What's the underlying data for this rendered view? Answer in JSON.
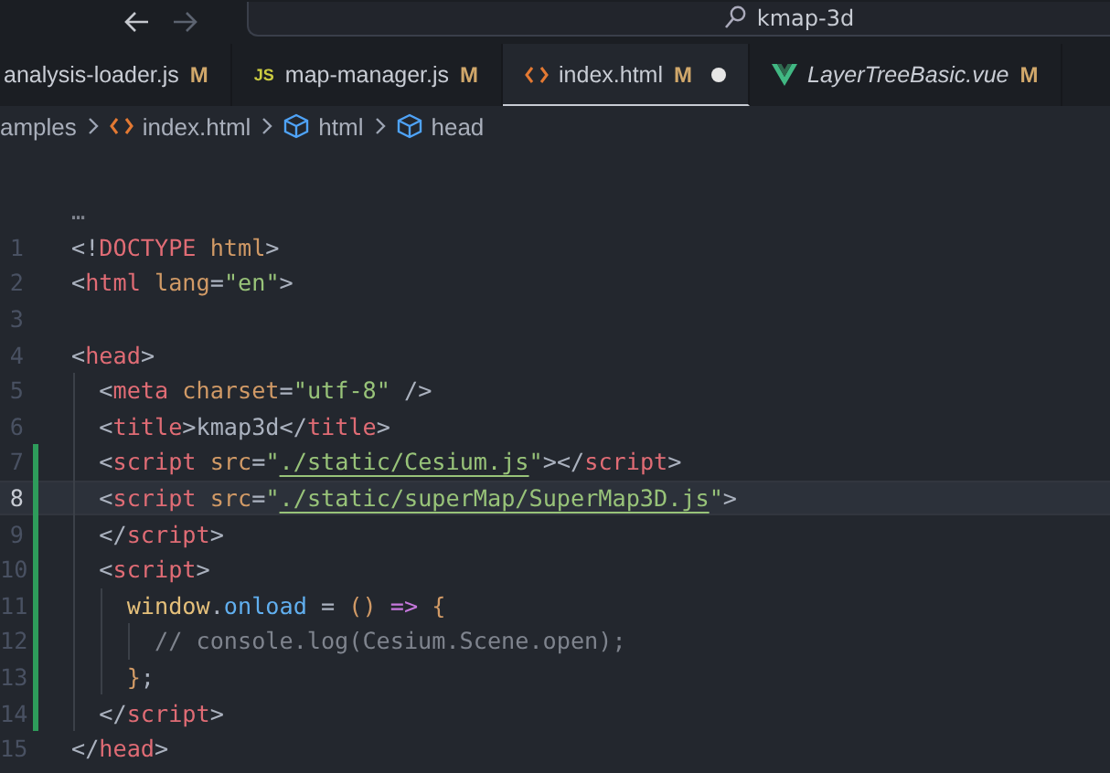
{
  "title_bar": {
    "search": {
      "value": "kmap-3d"
    }
  },
  "tabs": [
    {
      "label": "analysis-loader.js",
      "badge": "M",
      "selected": false,
      "dirty": false,
      "italic": false
    },
    {
      "label": "map-manager.js",
      "kind": "js",
      "icon_text": "JS",
      "badge": "M",
      "selected": false,
      "dirty": false,
      "italic": false
    },
    {
      "label": "index.html",
      "kind": "html",
      "badge": "M",
      "selected": true,
      "dirty": true,
      "italic": false
    },
    {
      "label": "LayerTreeBasic.vue",
      "kind": "vue",
      "badge": "M",
      "selected": false,
      "dirty": false,
      "italic": true
    }
  ],
  "breadcrumb": [
    {
      "label": "amples",
      "kind": "folder"
    },
    {
      "label": "index.html",
      "kind": "html"
    },
    {
      "label": "html",
      "kind": "element"
    },
    {
      "label": "head",
      "kind": "element"
    }
  ],
  "editor": {
    "fold_marker": "…",
    "lines": [
      {
        "number": "1",
        "modified": false,
        "current": false,
        "tokens": [
          {
            "kind": "punct",
            "text": "<!"
          },
          {
            "kind": "tag",
            "text": "DOCTYPE"
          },
          {
            "kind": "attr",
            "text": " html"
          },
          {
            "kind": "punct",
            "text": ">"
          }
        ]
      },
      {
        "number": "2",
        "modified": false,
        "current": false,
        "tokens": [
          {
            "kind": "punct",
            "text": "<"
          },
          {
            "kind": "tag",
            "text": "html"
          },
          {
            "kind": "attr",
            "text": " lang"
          },
          {
            "kind": "punct",
            "text": "="
          },
          {
            "kind": "string",
            "text": "\"en\""
          },
          {
            "kind": "punct",
            "text": ">"
          }
        ]
      },
      {
        "number": "3",
        "modified": false,
        "current": false
      },
      {
        "number": "4",
        "modified": false,
        "current": false,
        "tokens": [
          {
            "kind": "punct",
            "text": "<"
          },
          {
            "kind": "tag",
            "text": "head"
          },
          {
            "kind": "punct",
            "text": ">"
          }
        ]
      },
      {
        "number": "5",
        "modified": false,
        "current": false,
        "tokens": [
          {
            "kind": "punct",
            "text": "  <"
          },
          {
            "kind": "tag",
            "text": "meta"
          },
          {
            "kind": "attr",
            "text": " charset"
          },
          {
            "kind": "punct",
            "text": "="
          },
          {
            "kind": "string",
            "text": "\"utf-8\""
          },
          {
            "kind": "punct",
            "text": " />"
          }
        ]
      },
      {
        "number": "6",
        "modified": false,
        "current": false,
        "tokens": [
          {
            "kind": "punct",
            "text": "  <"
          },
          {
            "kind": "tag",
            "text": "title"
          },
          {
            "kind": "punct",
            "text": ">"
          },
          {
            "kind": "text",
            "text": "kmap3d"
          },
          {
            "kind": "punct",
            "text": "</"
          },
          {
            "kind": "tag",
            "text": "title"
          },
          {
            "kind": "punct",
            "text": ">"
          }
        ]
      },
      {
        "number": "7",
        "modified": true,
        "current": false,
        "tokens": [
          {
            "kind": "punct",
            "text": "  <"
          },
          {
            "kind": "tag",
            "text": "script"
          },
          {
            "kind": "attr",
            "text": " src"
          },
          {
            "kind": "punct",
            "text": "="
          },
          {
            "kind": "string",
            "text": "\""
          },
          {
            "kind": "link",
            "text": "./static/Cesium.js"
          },
          {
            "kind": "string",
            "text": "\""
          },
          {
            "kind": "punct",
            "text": "></"
          },
          {
            "kind": "tag",
            "text": "script"
          },
          {
            "kind": "punct",
            "text": ">"
          }
        ]
      },
      {
        "number": "8",
        "modified": true,
        "current": true,
        "tokens": [
          {
            "kind": "punct",
            "text": "  <"
          },
          {
            "kind": "tag",
            "text": "script"
          },
          {
            "kind": "attr",
            "text": " src"
          },
          {
            "kind": "punct",
            "text": "="
          },
          {
            "kind": "string",
            "text": "\""
          },
          {
            "kind": "link",
            "text": "./static/superMap/SuperMap3D.js"
          },
          {
            "kind": "string",
            "text": "\""
          },
          {
            "kind": "punct",
            "text": ">"
          }
        ]
      },
      {
        "number": "9",
        "modified": true,
        "current": false,
        "tokens": [
          {
            "kind": "punct",
            "text": "  </"
          },
          {
            "kind": "tag",
            "text": "script"
          },
          {
            "kind": "punct",
            "text": ">"
          }
        ]
      },
      {
        "number": "10",
        "modified": true,
        "current": false,
        "tokens": [
          {
            "kind": "punct",
            "text": "  <"
          },
          {
            "kind": "tag",
            "text": "script"
          },
          {
            "kind": "punct",
            "text": ">"
          }
        ]
      },
      {
        "number": "11",
        "modified": true,
        "current": false,
        "tokens": [
          {
            "kind": "var",
            "text": "    window"
          },
          {
            "kind": "punct",
            "text": "."
          },
          {
            "kind": "prop",
            "text": "onload"
          },
          {
            "kind": "punct",
            "text": " = "
          },
          {
            "kind": "paren",
            "text": "()"
          },
          {
            "kind": "op",
            "text": " =>"
          },
          {
            "kind": "paren",
            "text": " {"
          }
        ]
      },
      {
        "number": "12",
        "modified": true,
        "current": false,
        "tokens": [
          {
            "kind": "comment",
            "text": "      // console.log(Cesium.Scene.open);"
          }
        ]
      },
      {
        "number": "13",
        "modified": true,
        "current": false,
        "tokens": [
          {
            "kind": "paren",
            "text": "    }"
          },
          {
            "kind": "punct",
            "text": ";"
          }
        ]
      },
      {
        "number": "14",
        "modified": true,
        "current": false,
        "tokens": [
          {
            "kind": "punct",
            "text": "  </"
          },
          {
            "kind": "tag",
            "text": "script"
          },
          {
            "kind": "punct",
            "text": ">"
          }
        ]
      },
      {
        "number": "15",
        "modified": false,
        "current": false,
        "tokens": [
          {
            "kind": "punct",
            "text": "</"
          },
          {
            "kind": "tag",
            "text": "head"
          },
          {
            "kind": "punct",
            "text": ">"
          }
        ]
      }
    ]
  }
}
